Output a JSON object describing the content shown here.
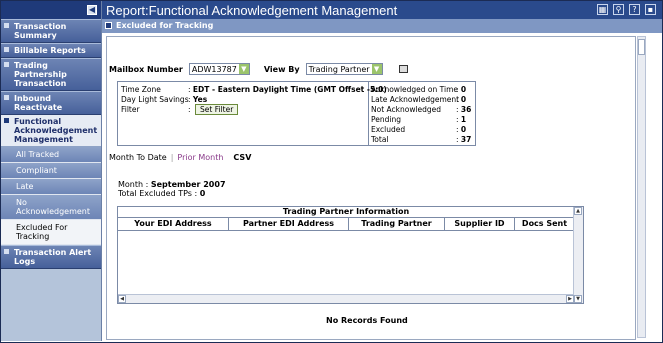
{
  "sidebar": {
    "items": [
      {
        "label": "Transaction Summary"
      },
      {
        "label": "Billable Reports"
      },
      {
        "label": "Trading Partnership Transaction"
      },
      {
        "label": "Inbound Reactivate"
      }
    ],
    "section": {
      "label": "Functional Acknowledgement Management"
    },
    "subitems": [
      {
        "label": "All Tracked"
      },
      {
        "label": "Compliant"
      },
      {
        "label": "Late"
      },
      {
        "label": "No Acknowledgement"
      },
      {
        "label": "Excluded For Tracking"
      }
    ],
    "bottom_item": {
      "label": "Transaction Alert Logs"
    }
  },
  "header": {
    "title": "Report:Functional Acknowledgement Management"
  },
  "subheader": {
    "label": "Excluded for Tracking"
  },
  "controls": {
    "mailbox_label": "Mailbox Number",
    "mailbox_value": "ADW13787",
    "viewby_label": "View By",
    "viewby_value": "Trading Partner"
  },
  "info": {
    "timezone_label": "Time Zone",
    "timezone_value": "EDT - Eastern Daylight Time (GMT Offset -5:0)",
    "dst_label": "Day Light Savings",
    "dst_value": "Yes",
    "filter_label": "Filter",
    "setfilter_label": "Set Filter",
    "stats": [
      {
        "label": "Acknowledged on Time",
        "value": "0"
      },
      {
        "label": "Late Acknowledgement",
        "value": "0"
      },
      {
        "label": "Not Acknowledged",
        "value": "36"
      },
      {
        "label": "Pending",
        "value": "1"
      },
      {
        "label": "Excluded",
        "value": "0"
      },
      {
        "label": "Total",
        "value": "37"
      }
    ]
  },
  "tabs": {
    "month_to_date": "Month To Date",
    "prior_month": "Prior Month",
    "csv": "CSV"
  },
  "summary": {
    "month_label": "Month",
    "month_value": "September 2007",
    "excluded_label": "Total Excluded TPs",
    "excluded_value": "0"
  },
  "table": {
    "group_header": "Trading Partner Information",
    "columns": [
      "Your EDI Address",
      "Partner EDI Address",
      "Trading Partner",
      "Supplier ID",
      "Docs Sent"
    ],
    "empty_message": "No Records Found"
  }
}
